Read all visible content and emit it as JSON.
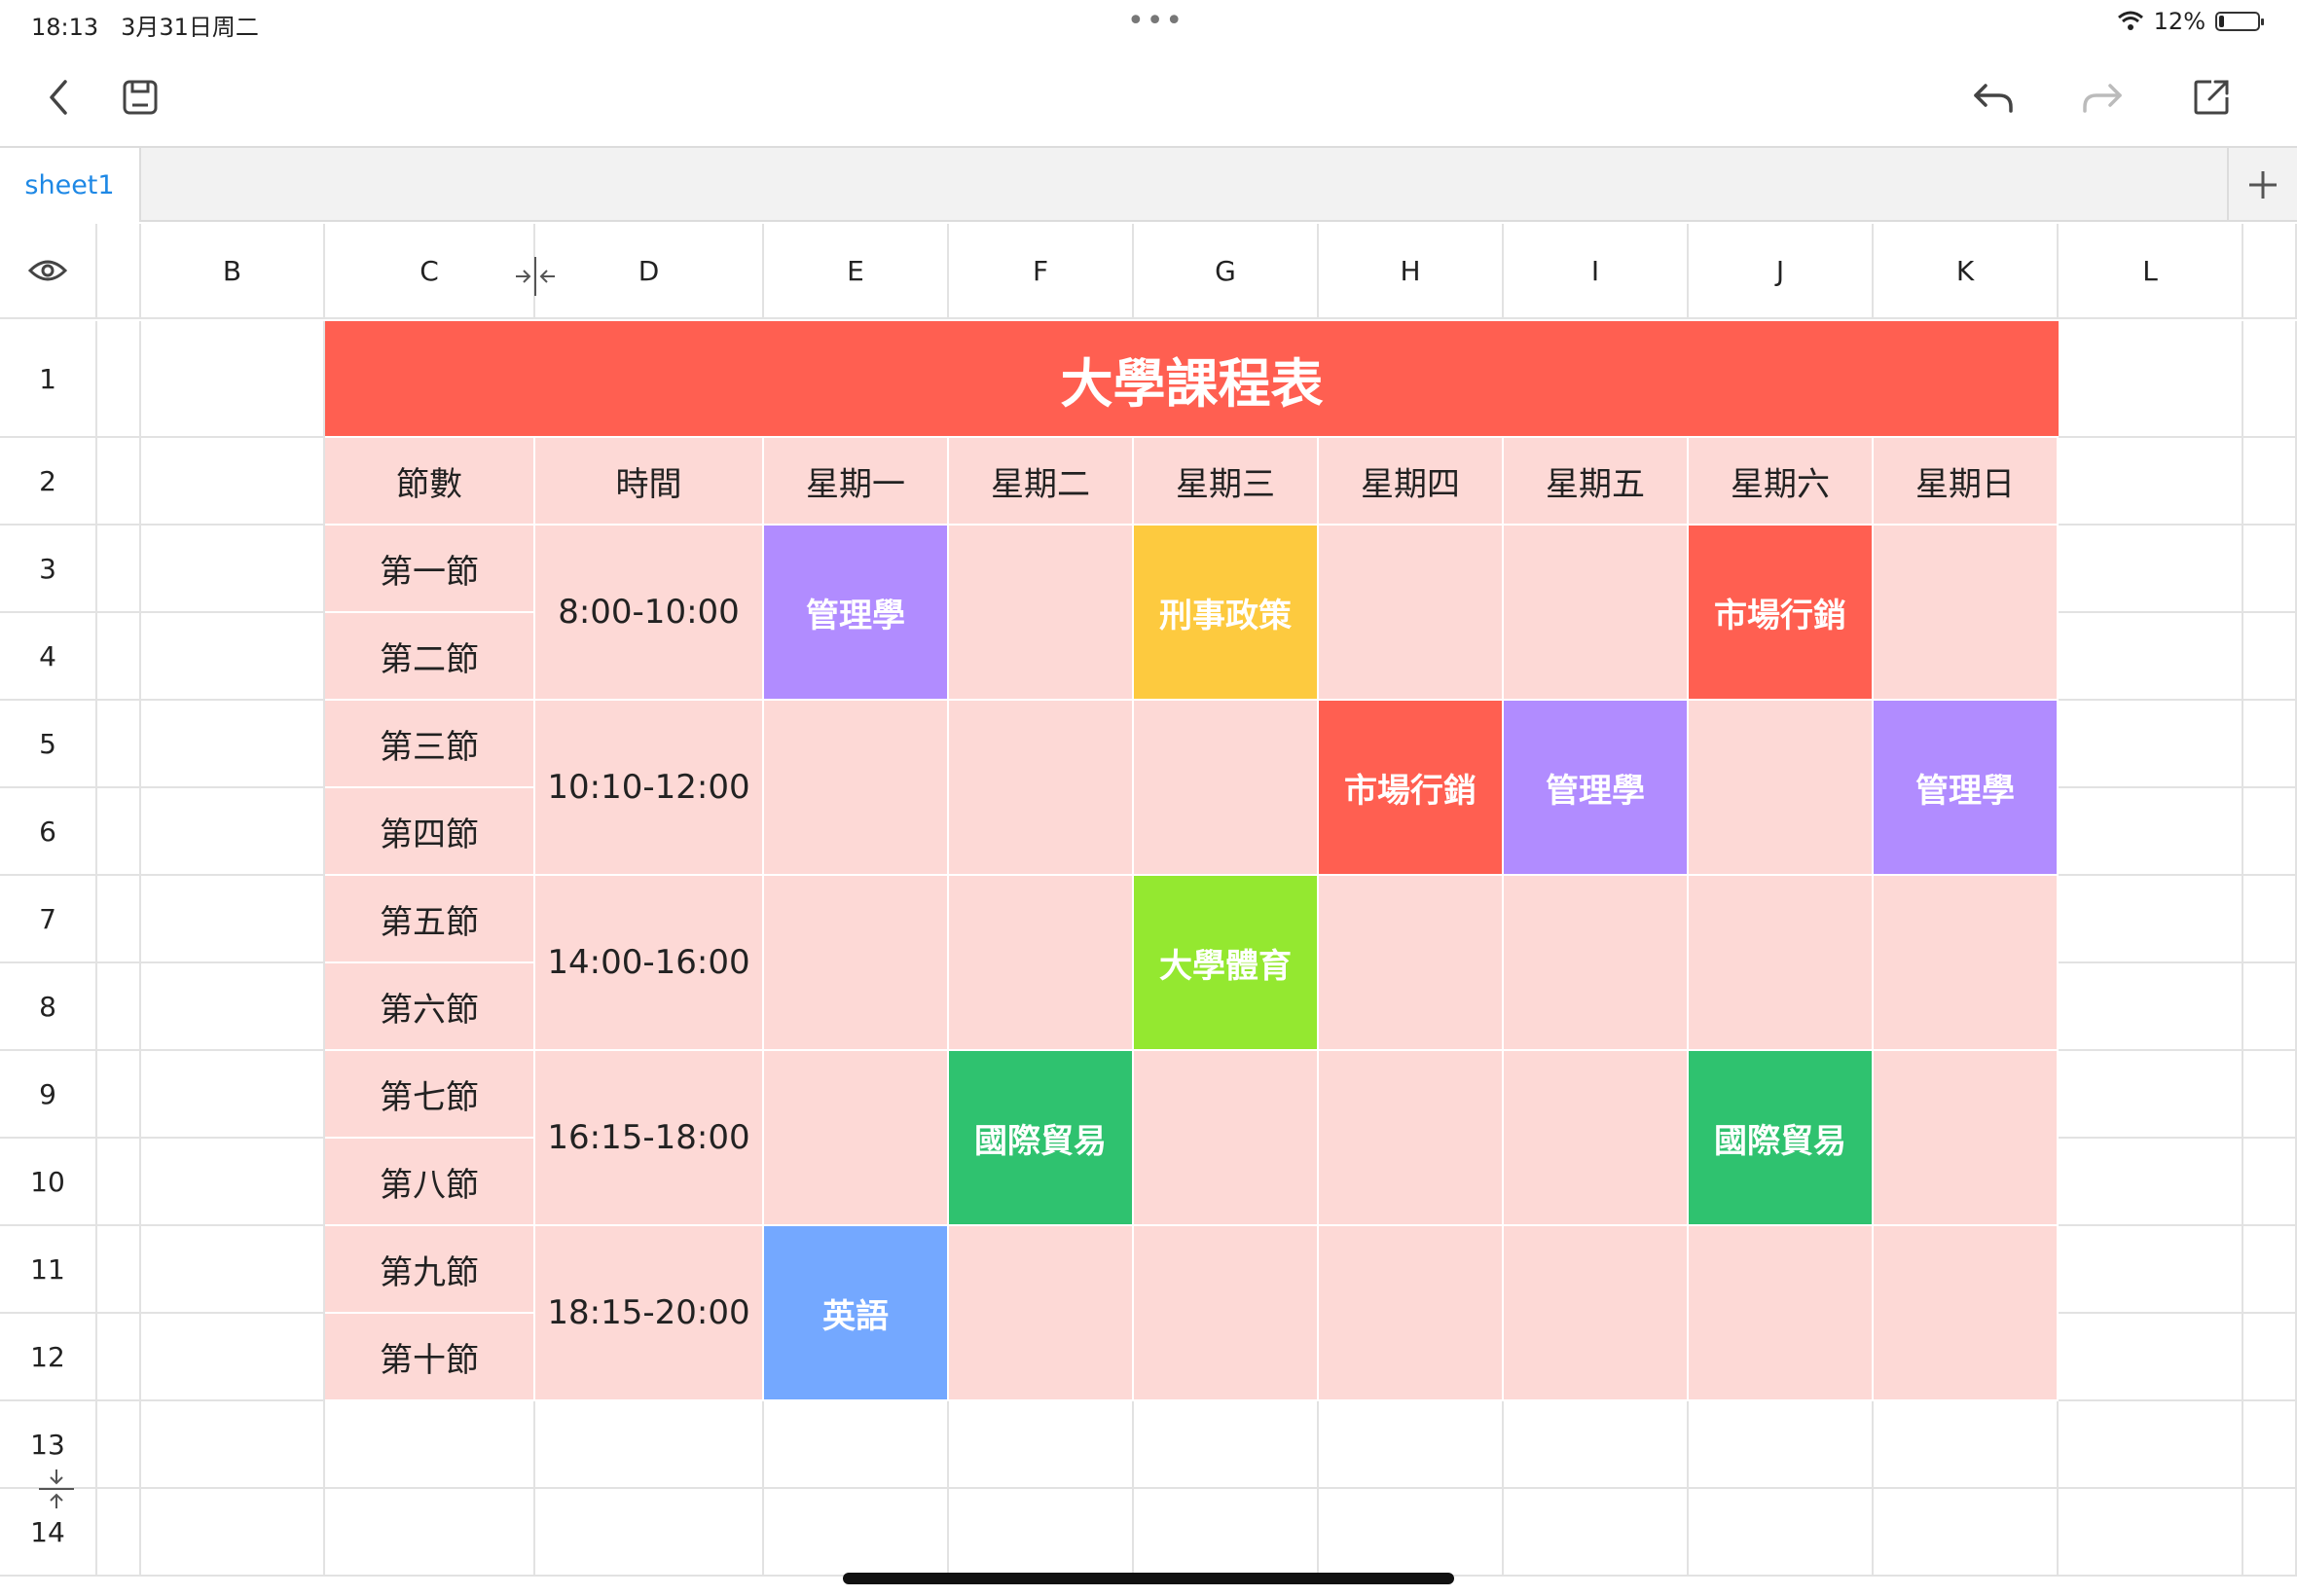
{
  "status_bar": {
    "time": "18:13",
    "date": "3月31日周二",
    "battery_percent": "12%",
    "battery_level": 0.12
  },
  "toolbar": {
    "back_icon": "chevron-left-icon",
    "save_icon": "save-icon",
    "undo_icon": "undo-icon",
    "redo_icon": "redo-icon",
    "share_icon": "share-icon"
  },
  "sheet_tabs": [
    {
      "label": "sheet1",
      "active": true
    }
  ],
  "columns": [
    "B",
    "C",
    "D",
    "E",
    "F",
    "G",
    "H",
    "I",
    "J",
    "K",
    "L"
  ],
  "rows": [
    "1",
    "2",
    "3",
    "4",
    "5",
    "6",
    "7",
    "8",
    "9",
    "10",
    "11",
    "12",
    "13",
    "14"
  ],
  "timetable": {
    "title": "大學課程表",
    "headers": [
      "節數",
      "時間",
      "星期一",
      "星期二",
      "星期三",
      "星期四",
      "星期五",
      "星期六",
      "星期日"
    ],
    "periods": [
      "第一節",
      "第二節",
      "第三節",
      "第四節",
      "第五節",
      "第六節",
      "第七節",
      "第八節",
      "第九節",
      "第十節"
    ],
    "times": [
      "8:00-10:00",
      "10:10-12:00",
      "14:00-16:00",
      "16:15-18:00",
      "18:15-20:00"
    ],
    "courses": [
      {
        "name": "管理學",
        "day": "星期一",
        "slot": 1,
        "color": "#b18cff"
      },
      {
        "name": "刑事政策",
        "day": "星期三",
        "slot": 1,
        "color": "#fdca3f"
      },
      {
        "name": "市場行銷",
        "day": "星期六",
        "slot": 1,
        "color": "#ff5f51"
      },
      {
        "name": "市場行銷",
        "day": "星期四",
        "slot": 2,
        "color": "#ff5f51"
      },
      {
        "name": "管理學",
        "day": "星期五",
        "slot": 2,
        "color": "#b18cff"
      },
      {
        "name": "管理學",
        "day": "星期日",
        "slot": 2,
        "color": "#b18cff"
      },
      {
        "name": "大學體育",
        "day": "星期三",
        "slot": 3,
        "color": "#94e830"
      },
      {
        "name": "國際貿易",
        "day": "星期二",
        "slot": 4,
        "color": "#2fc26f"
      },
      {
        "name": "國際貿易",
        "day": "星期六",
        "slot": 4,
        "color": "#2fc26f"
      },
      {
        "name": "英語",
        "day": "星期一",
        "slot": 5,
        "color": "#74a8ff"
      }
    ]
  }
}
